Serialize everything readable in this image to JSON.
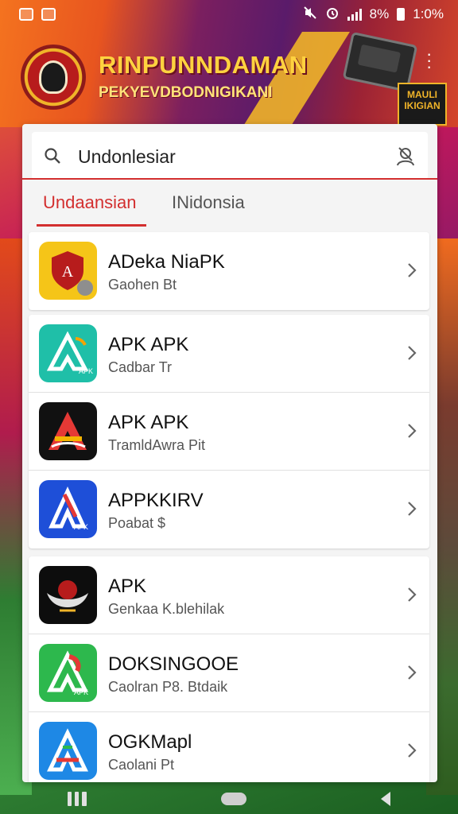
{
  "status_bar": {
    "battery_percent": "8%",
    "time": "1:0%"
  },
  "banner": {
    "title": "RINPUNNDAMAN",
    "subtitle": "PEKYEVDBODNIGIKANI",
    "badge_text": "MAULI\nIKIGIAN"
  },
  "search": {
    "value": "Undonlesiar"
  },
  "tabs": [
    {
      "label": "Undaansian",
      "active": true
    },
    {
      "label": "INidonsia",
      "active": false
    }
  ],
  "apps": [
    {
      "name": "ADeka NiaPK",
      "subtitle": "Gaohen Bt",
      "icon": "shield-icon"
    },
    {
      "name": "APK APK",
      "subtitle": "Cadbar Tr",
      "icon": "apk-teal-icon"
    },
    {
      "name": "APK APK",
      "subtitle": "TramldAwra Pit",
      "icon": "apk-black-icon"
    },
    {
      "name": "APPKKIRV",
      "subtitle": "Poabat $",
      "icon": "apk-blue-icon"
    },
    {
      "name": "APK",
      "subtitle": "Genkaa K.blehilak",
      "icon": "garuda-icon"
    },
    {
      "name": "DOKSINGOOE",
      "subtitle": "Caolran P8. Btdaik",
      "icon": "apk-green-icon"
    },
    {
      "name": "OGKMapl",
      "subtitle": "Caolani Pt",
      "icon": "apk-sky-icon"
    }
  ],
  "colors": {
    "accent": "#d32f2f",
    "banner_text": "#ffd23f"
  }
}
